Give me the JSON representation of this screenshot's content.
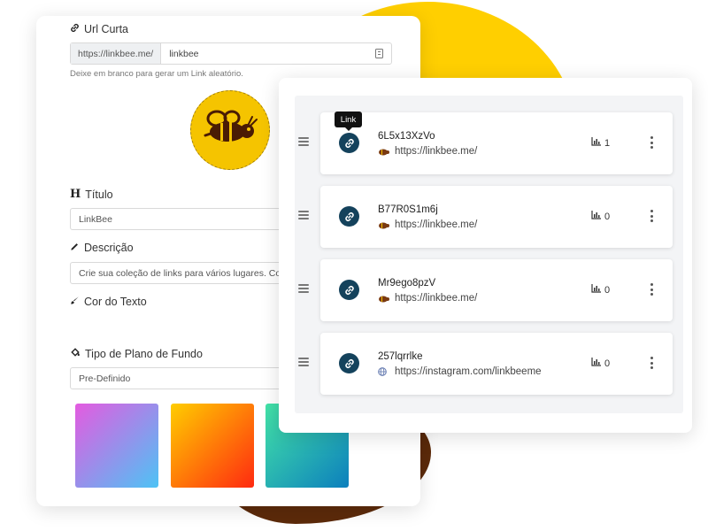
{
  "form": {
    "short_url": {
      "label": "Url Curta",
      "prefix": "https://linkbee.me/",
      "value": "linkbee",
      "help": "Deixe em branco para gerar um Link aleatório."
    },
    "title_field": {
      "label": "Título",
      "value": "LinkBee"
    },
    "description_field": {
      "label": "Descrição",
      "value": "Crie sua coleção de links para vários lugares. Com"
    },
    "text_color_field": {
      "label": "Cor do Texto"
    },
    "background_type_field": {
      "label": "Tipo de Plano de Fundo",
      "value": "Pre-Definido"
    },
    "gradients": [
      {
        "name": "pink-blue",
        "from": "#e45be0",
        "to": "#4dc3f5"
      },
      {
        "name": "orange-red",
        "from": "#ffcd00",
        "to": "#ff2a10"
      },
      {
        "name": "green-blue",
        "from": "#43e3a7",
        "to": "#0c7fbd"
      }
    ]
  },
  "tooltip": "Link",
  "links": [
    {
      "title": "6L5x13XzVo",
      "url": "https://linkbee.me/",
      "site_icon": "bee-icon",
      "clicks": "1"
    },
    {
      "title": "B77R0S1m6j",
      "url": "https://linkbee.me/",
      "site_icon": "bee-icon",
      "clicks": "0"
    },
    {
      "title": "Mr9ego8pzV",
      "url": "https://linkbee.me/",
      "site_icon": "bee-icon",
      "clicks": "0"
    },
    {
      "title": "257lqrrlke",
      "url": "https://instagram.com/linkbeeme",
      "site_icon": "globe-icon",
      "clicks": "0"
    }
  ],
  "colors": {
    "brand_yellow": "#ffcf00",
    "brand_brown": "#5c2a0a",
    "link_icon_bg": "#14425c"
  }
}
